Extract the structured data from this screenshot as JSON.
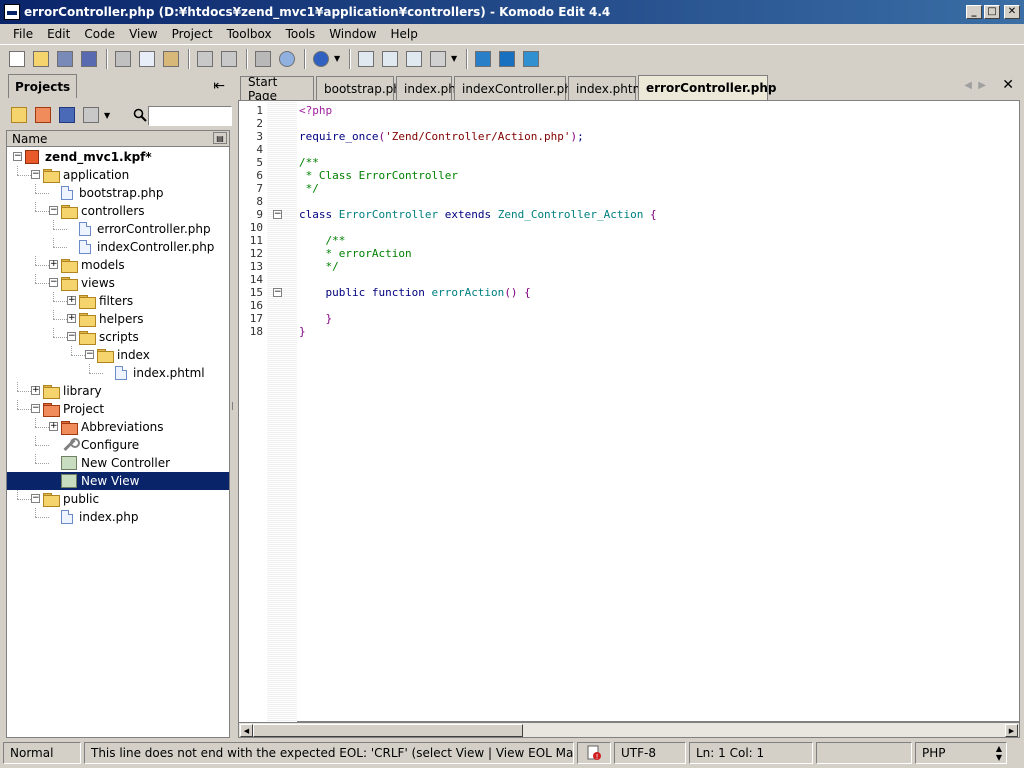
{
  "window": {
    "title": "errorController.php (D:¥htdocs¥zend_mvc1¥application¥controllers) - Komodo Edit 4.4",
    "controls": [
      "_",
      "□",
      "✕"
    ]
  },
  "menubar": {
    "items": [
      {
        "label": "File"
      },
      {
        "label": "Edit"
      },
      {
        "label": "Code"
      },
      {
        "label": "View"
      },
      {
        "label": "Project"
      },
      {
        "label": "Toolbox"
      },
      {
        "label": "Tools"
      },
      {
        "label": "Window"
      },
      {
        "label": "Help"
      }
    ]
  },
  "toolbar": {
    "icons": [
      "new-file-icon",
      "open-file-icon",
      "save-icon",
      "save-all-icon",
      "cut-icon",
      "copy-icon",
      "paste-icon",
      "undo-icon",
      "redo-icon",
      "print-icon",
      "find-icon",
      "browser-preview-icon",
      "toggle-left-pane-icon",
      "toggle-right-pane-icon",
      "toggle-bottom-pane-icon",
      "macro-icon",
      "komodo-site-icon",
      "community-icon",
      "extensions-icon"
    ]
  },
  "left_pane": {
    "tab_label": "Projects",
    "column_header": "Name",
    "tree": [
      {
        "label": "zend_mvc1.kpf*",
        "level": 0,
        "icon": "kpf",
        "expanded": true,
        "bold": true
      },
      {
        "label": "application",
        "level": 1,
        "icon": "folder",
        "expanded": true
      },
      {
        "label": "bootstrap.php",
        "level": 2,
        "icon": "file"
      },
      {
        "label": "controllers",
        "level": 2,
        "icon": "folder",
        "expanded": true
      },
      {
        "label": "errorController.php",
        "level": 3,
        "icon": "file"
      },
      {
        "label": "indexController.php",
        "level": 3,
        "icon": "file"
      },
      {
        "label": "models",
        "level": 2,
        "icon": "folder",
        "expanded": false
      },
      {
        "label": "views",
        "level": 2,
        "icon": "folder",
        "expanded": true
      },
      {
        "label": "filters",
        "level": 3,
        "icon": "folder",
        "expanded": false
      },
      {
        "label": "helpers",
        "level": 3,
        "icon": "folder",
        "expanded": false
      },
      {
        "label": "scripts",
        "level": 3,
        "icon": "folder",
        "expanded": true
      },
      {
        "label": "index",
        "level": 4,
        "icon": "folder",
        "expanded": true
      },
      {
        "label": "index.phtml",
        "level": 5,
        "icon": "file"
      },
      {
        "label": "library",
        "level": 1,
        "icon": "folder",
        "expanded": false
      },
      {
        "label": "Project",
        "level": 1,
        "icon": "folder-red",
        "expanded": true
      },
      {
        "label": "Abbreviations",
        "level": 2,
        "icon": "folder-red",
        "expanded": false
      },
      {
        "label": "Configure",
        "level": 2,
        "icon": "wrench"
      },
      {
        "label": "New Controller",
        "level": 2,
        "icon": "macro"
      },
      {
        "label": "New View",
        "level": 2,
        "icon": "macro",
        "selected": true
      },
      {
        "label": "public",
        "level": 1,
        "icon": "folder",
        "expanded": true
      },
      {
        "label": "index.php",
        "level": 2,
        "icon": "file"
      }
    ]
  },
  "editor": {
    "tabs": [
      {
        "label": "Start Page"
      },
      {
        "label": "bootstrap.php"
      },
      {
        "label": "index.php"
      },
      {
        "label": "indexController.php"
      },
      {
        "label": "index.phtml"
      },
      {
        "label": "errorController.php",
        "active": true
      }
    ],
    "lines": [
      {
        "n": "1",
        "tokens": [
          [
            "php",
            "<?php"
          ]
        ]
      },
      {
        "n": "2",
        "tokens": []
      },
      {
        "n": "3",
        "tokens": [
          [
            "kw",
            "require_once"
          ],
          [
            "br",
            "("
          ],
          [
            "str",
            "'Zend/Controller/Action.php'"
          ],
          [
            "br",
            ")"
          ],
          [
            "kw",
            ";"
          ]
        ]
      },
      {
        "n": "4",
        "tokens": []
      },
      {
        "n": "5",
        "tokens": [
          [
            "cm",
            "/**"
          ]
        ]
      },
      {
        "n": "6",
        "tokens": [
          [
            "cm",
            " * Class ErrorController"
          ]
        ]
      },
      {
        "n": "7",
        "tokens": [
          [
            "cm",
            " */"
          ]
        ]
      },
      {
        "n": "8",
        "tokens": []
      },
      {
        "n": "9",
        "tokens": [
          [
            "kw",
            "class "
          ],
          [
            "id",
            "ErrorController"
          ],
          [
            "kw",
            " extends "
          ],
          [
            "id",
            "Zend_Controller_Action"
          ],
          [
            "br",
            " {"
          ]
        ],
        "fold": true
      },
      {
        "n": "10",
        "tokens": []
      },
      {
        "n": "11",
        "tokens": [
          [
            "cm",
            "    /**"
          ]
        ]
      },
      {
        "n": "12",
        "tokens": [
          [
            "cm",
            "    * errorAction"
          ]
        ]
      },
      {
        "n": "13",
        "tokens": [
          [
            "cm",
            "    */"
          ]
        ]
      },
      {
        "n": "14",
        "tokens": []
      },
      {
        "n": "15",
        "tokens": [
          [
            "kw",
            "    public function "
          ],
          [
            "id",
            "errorAction"
          ],
          [
            "br",
            "() {"
          ]
        ],
        "fold": true
      },
      {
        "n": "16",
        "tokens": []
      },
      {
        "n": "17",
        "tokens": [
          [
            "br",
            "    }"
          ]
        ]
      },
      {
        "n": "18",
        "tokens": [
          [
            "br",
            "}"
          ]
        ]
      }
    ]
  },
  "statusbar": {
    "mode": "Normal",
    "message": "This line does not end with the expected EOL: 'CRLF' (select View | View EOL Markers)",
    "encoding": "UTF-8",
    "position": "Ln: 1 Col: 1",
    "language": "PHP"
  }
}
